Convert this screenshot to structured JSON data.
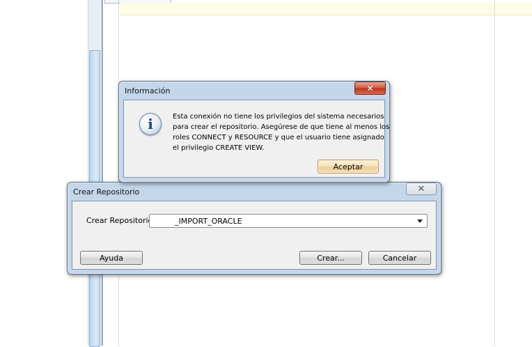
{
  "info_dialog": {
    "title": "Información",
    "close_glyph": "✕",
    "message_lines": [
      "Esta conexión no tiene los privilegios del sistema necesarios",
      "para crear el repositorio. Asegúrese de que tiene al menos los",
      "roles CONNECT y RESOURCE y que el usuario tiene asignado",
      "el privilegio CREATE VIEW."
    ],
    "icon": "info-icon",
    "icon_glyph": "i",
    "accept_label": "Aceptar"
  },
  "repo_dialog": {
    "title": "Crear Repositorio",
    "close_glyph": "✕",
    "field_label": "Crear Repositorio",
    "selected_value": "_IMPORT_ORACLE",
    "help_label": "Ayuda",
    "create_label": "Crear...",
    "cancel_label": "Cancelar"
  },
  "colors": {
    "frame": "#c4d6ea",
    "client": "#f0f0f0",
    "close_active": "#c7432b",
    "default_button": "#f6dfb7",
    "editor_highlight": "#fffce5"
  }
}
